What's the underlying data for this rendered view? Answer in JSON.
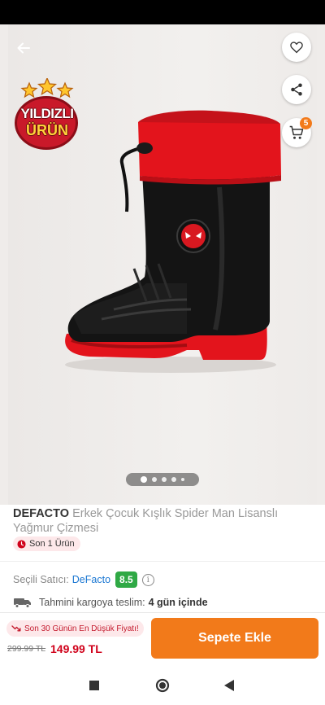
{
  "badge": {
    "line1": "YILDIZLI",
    "line2": "ÜRÜN"
  },
  "cart": {
    "count": "5"
  },
  "carousel": {
    "total": 5,
    "active": 0
  },
  "product": {
    "brand": "DEFACTO",
    "name": "Erkek Çocuk Kışlık Spider Man Lisanslı Yağmur Çizmesi",
    "stock": "Son 1 Ürün"
  },
  "seller": {
    "label": "Seçili Satıcı:",
    "name": "DeFacto",
    "rating": "8.5",
    "info": "i"
  },
  "shipping": {
    "label": "Tahmini kargoya teslim:",
    "value": "4 gün içinde"
  },
  "pricing": {
    "lowest_label": "Son 30 Günün En Düşük Fiyatı!",
    "old_price": "299.99 TL",
    "new_price": "149.99 TL"
  },
  "actions": {
    "add_to_cart": "Sepete Ekle"
  },
  "colors": {
    "accent": "#f27a1a",
    "price": "#d0021b",
    "rating": "#2fa945",
    "link": "#1976d2"
  },
  "icons": [
    "back-arrow-icon",
    "heart-icon",
    "share-icon",
    "cart-icon",
    "clock-icon",
    "truck-icon",
    "trend-down-icon",
    "nav-recents-icon",
    "nav-home-icon",
    "nav-back-icon"
  ]
}
